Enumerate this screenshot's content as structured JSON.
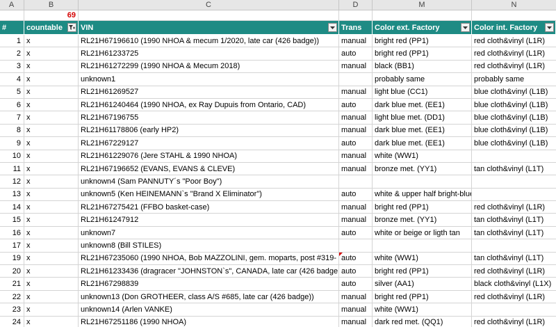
{
  "columns": [
    "A",
    "B",
    "C",
    "D",
    "M",
    "N"
  ],
  "filtered_count": "69",
  "headers": {
    "num": "#",
    "countable": "countable",
    "vin": "VIN",
    "trans": "Trans",
    "color_ext": "Color ext. Factory",
    "color_int": "Color int. Factory"
  },
  "rows": [
    {
      "num": "1",
      "countable": "x",
      "vin": "RL21H67196610 (1990 NHOA & mecum 1/2020, late car (426 badge))",
      "trans": "manual",
      "color_ext": "bright red (PP1)",
      "color_int": "red cloth&vinyl (L1R)"
    },
    {
      "num": "2",
      "countable": "x",
      "vin": "RL21H61233725",
      "trans": "auto",
      "color_ext": "bright red (PP1)",
      "color_int": "red cloth&vinyl (L1R)"
    },
    {
      "num": "3",
      "countable": "x",
      "vin": "RL21H61272299 (1990 NHOA & Mecum 2018)",
      "trans": "manual",
      "color_ext": "black (BB1)",
      "color_int": "red cloth&vinyl (L1R)"
    },
    {
      "num": "4",
      "countable": "x",
      "vin": "unknown1",
      "trans": "",
      "color_ext": "probably same",
      "color_int": "probably same"
    },
    {
      "num": "5",
      "countable": "x",
      "vin": "RL21H61269527",
      "trans": "manual",
      "color_ext": "light blue (CC1)",
      "color_int": "blue cloth&vinyl (L1B)"
    },
    {
      "num": "6",
      "countable": "x",
      "vin": "RL21H61240464 (1990 NHOA, ex Ray Dupuis from Ontario, CAD)",
      "trans": "auto",
      "color_ext": "dark blue met. (EE1)",
      "color_int": "blue cloth&vinyl (L1B)"
    },
    {
      "num": "7",
      "countable": "x",
      "vin": "RL21H67196755",
      "trans": "manual",
      "color_ext": "light blue met. (DD1)",
      "color_int": "blue cloth&vinyl (L1B)"
    },
    {
      "num": "8",
      "countable": "x",
      "vin": "RL21H61178806 (early HP2)",
      "trans": "manual",
      "color_ext": "dark blue met. (EE1)",
      "color_int": "blue cloth&vinyl (L1B)"
    },
    {
      "num": "9",
      "countable": "x",
      "vin": "RL21H67229127",
      "trans": "auto",
      "color_ext": "dark blue met. (EE1)",
      "color_int": "blue cloth&vinyl (L1B)"
    },
    {
      "num": "10",
      "countable": "x",
      "vin": "RL21H61229076 (Jere STAHL & 1990 NHOA)",
      "trans": "manual",
      "color_ext": "white (WW1)",
      "color_int": ""
    },
    {
      "num": "11",
      "countable": "x",
      "vin": "RL21H67196652 (EVANS, EVANS & CLEVE)",
      "trans": "manual",
      "color_ext": "bronze met. (YY1)",
      "color_int": "tan cloth&vinyl (L1T)"
    },
    {
      "num": "12",
      "countable": "x",
      "vin": "unknown4 (Sam PANNUTY´s \"Poor Boy\")",
      "trans": "",
      "color_ext": "",
      "color_int": ""
    },
    {
      "num": "13",
      "countable": "x",
      "vin": "unknown5 (Ken HEINEMANN`s \"Brand X Eliminator\")",
      "trans": "auto",
      "color_ext": "white & upper half bright-blue",
      "color_int": ""
    },
    {
      "num": "14",
      "countable": "x",
      "vin": "RL21H67275421 (FFBO basket-case)",
      "trans": "manual",
      "color_ext": "bright red (PP1)",
      "color_int": "red cloth&vinyl (L1R)"
    },
    {
      "num": "15",
      "countable": "x",
      "vin": "RL21H61247912",
      "trans": "manual",
      "color_ext": "bronze met. (YY1)",
      "color_int": "tan cloth&vinyl (L1T)"
    },
    {
      "num": "16",
      "countable": "x",
      "vin": "unknown7",
      "trans": "auto",
      "color_ext": "white or beige or ligth tan",
      "color_int": "tan cloth&vinyl (L1T)"
    },
    {
      "num": "17",
      "countable": "x",
      "vin": "unknown8 (Bill STILES)",
      "trans": "",
      "color_ext": "",
      "color_int": ""
    },
    {
      "num": "19",
      "countable": "x",
      "vin": "RL21H67235060 (1990 NHOA, Bob MAZZOLINI, gem. moparts, post #319-",
      "trans": "auto",
      "color_ext": "white (WW1)",
      "color_int": "tan cloth&vinyl (L1T)"
    },
    {
      "num": "20",
      "countable": "x",
      "vin": "RL21H61233436 (dragracer \"JOHNSTON`s\", CANADA, late car (426 badge",
      "trans": "auto",
      "color_ext": "bright red (PP1)",
      "color_int": "red cloth&vinyl (L1R)"
    },
    {
      "num": "21",
      "countable": "x",
      "vin": "RL21H67298839",
      "trans": "auto",
      "color_ext": "silver (AA1)",
      "color_int": "black cloth&vinyl (L1X)"
    },
    {
      "num": "22",
      "countable": "x",
      "vin": "unknown13 (Don GROTHEER, class A/S #685, late car (426 badge))",
      "trans": "manual",
      "color_ext": "bright red (PP1)",
      "color_int": "red cloth&vinyl (L1R)"
    },
    {
      "num": "23",
      "countable": "x",
      "vin": "unknown14 (Arlen VANKE)",
      "trans": "manual",
      "color_ext": "white (WW1)",
      "color_int": ""
    },
    {
      "num": "24",
      "countable": "x",
      "vin": "RL21H67251186 (1990 NHOA)",
      "trans": "manual",
      "color_ext": "dark red met. (QQ1)",
      "color_int": "red cloth&vinyl (L1R)"
    }
  ],
  "colors": {
    "header_bg": "#1e8b84",
    "count_text": "#d40000",
    "grid": "#d4d4d4"
  }
}
